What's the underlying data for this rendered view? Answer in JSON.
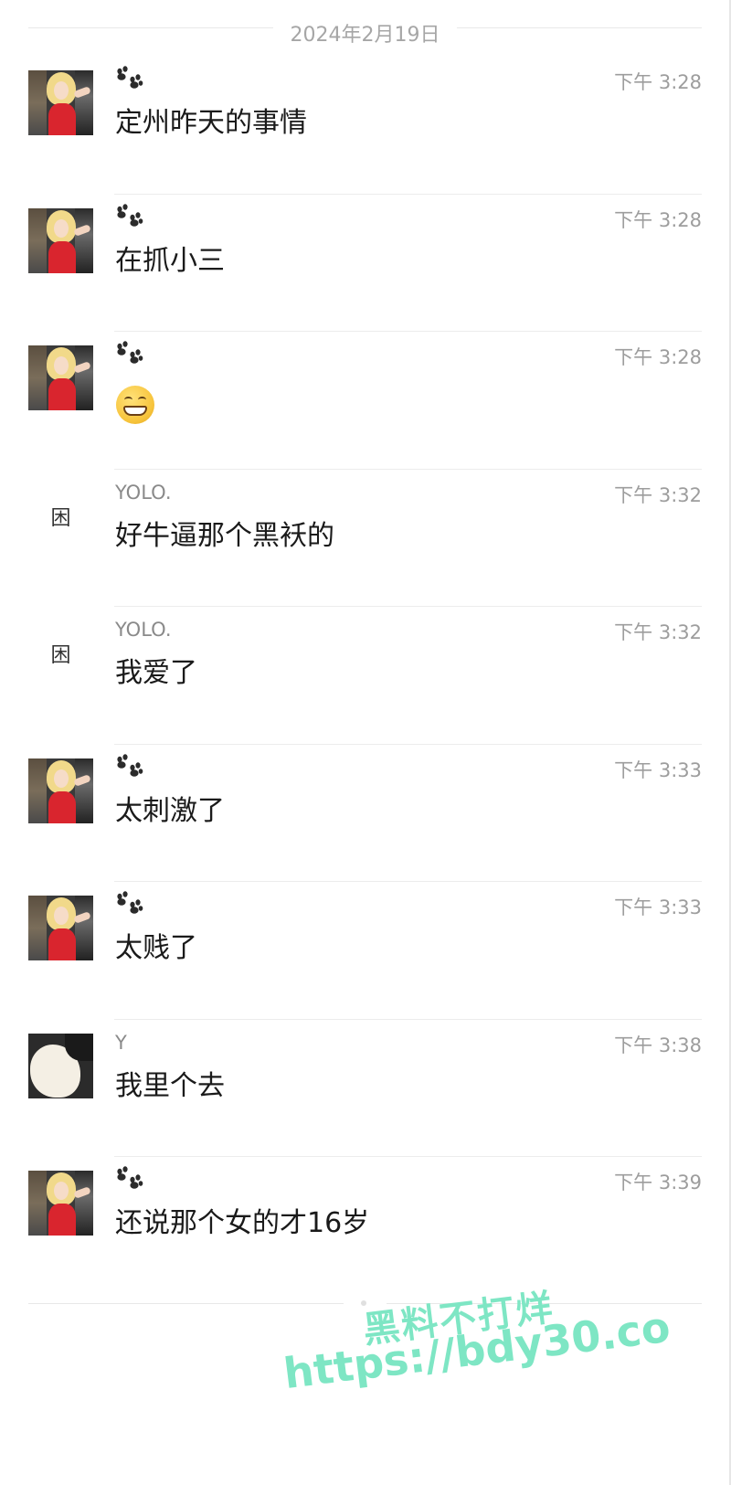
{
  "date_divider": "2024年2月19日",
  "messages": [
    {
      "avatar": "blonde-red-dress",
      "sender": "",
      "sender_icon": "paw-icon",
      "time": "下午 3:28",
      "text": "定州昨天的事情"
    },
    {
      "avatar": "blonde-red-dress",
      "sender": "",
      "sender_icon": "paw-icon",
      "time": "下午 3:28",
      "text": "在抓小三"
    },
    {
      "avatar": "blonde-red-dress",
      "sender": "",
      "sender_icon": "paw-icon",
      "time": "下午 3:28",
      "text": "",
      "emoji": "grinning-face-emoji"
    },
    {
      "avatar": "glyph",
      "avatar_glyph": "困",
      "sender": "YOLO.",
      "time": "下午 3:32",
      "text": "好牛逼那个黑袄的"
    },
    {
      "avatar": "glyph",
      "avatar_glyph": "困",
      "sender": "YOLO.",
      "time": "下午 3:32",
      "text": "我爱了"
    },
    {
      "avatar": "blonde-red-dress",
      "sender": "",
      "sender_icon": "paw-icon",
      "time": "下午 3:33",
      "text": "太刺激了"
    },
    {
      "avatar": "blonde-red-dress",
      "sender": "",
      "sender_icon": "paw-icon",
      "time": "下午 3:33",
      "text": "太贱了"
    },
    {
      "avatar": "white-pet",
      "sender": "Y",
      "time": "下午 3:38",
      "text": "我里个去"
    },
    {
      "avatar": "blonde-red-dress",
      "sender": "",
      "sender_icon": "paw-icon",
      "time": "下午 3:39",
      "text": "还说那个女的才16岁"
    }
  ],
  "watermark": {
    "line1": "黑料不打烊",
    "line2": "https://bdy30.co",
    "color": "#7ee6c4"
  }
}
